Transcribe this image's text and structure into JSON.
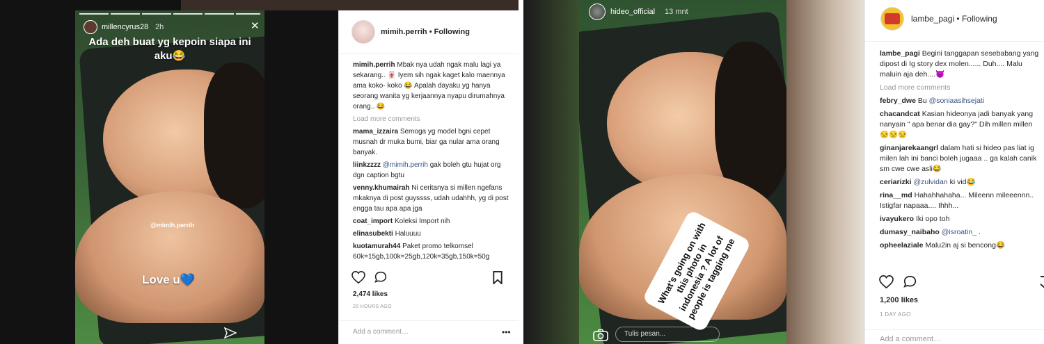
{
  "left": {
    "story": {
      "username": "millencyrus28",
      "time": "2h",
      "caption": "Ada deh buat yg kepoin siapa ini aku😂",
      "tag_text": "@mimih.perrih",
      "love_text": "Love u💙"
    },
    "post": {
      "username": "mimih.perrih",
      "follow_status": "Following",
      "caption_user": "mimih.perrih",
      "caption_text": "Mbak nya udah ngak malu lagi ya sekarang.. 🀄 Iyem sih ngak kaget kalo maennya ama koko- koko 😂 Apalah dayaku yg hanya seorang wanita yg kerjaannya nyapu dirumahnya orang.. 😂",
      "load_more": "Load more comments",
      "comments": [
        {
          "user": "mama_izzaira",
          "mention": "",
          "text": "Semoga yg model bgni cepet musnah dr muka bumi, biar ga nular ama orang banyak."
        },
        {
          "user": "liinkzzzz",
          "mention": "@mimih.perrih",
          "text": "gak boleh gtu hujat org dgn caption bgtu"
        },
        {
          "user": "venny.khumairah",
          "mention": "",
          "text": "Ni ceritanya si millen ngefans mkaknya di post guyssss, udah udahhh, yg di post engga tau apa apa jga"
        },
        {
          "user": "coat_import",
          "mention": "",
          "text": "Koleksi Import nih"
        },
        {
          "user": "elinasubekti",
          "mention": "",
          "text": "Haluuuu"
        },
        {
          "user": "kuotamurah44",
          "mention": "",
          "text": "Paket promo telkomsel 60k=15gb,100k=25gb,120k=35gb,150k=50g"
        }
      ],
      "likes": "2,474 likes",
      "time_ago": "20 HOURS AGO",
      "add_comment": "Add a comment…",
      "more_glyph": "•••"
    }
  },
  "right": {
    "story": {
      "username": "hideo_official",
      "time": "13 mnt",
      "sticker_text": "What's going on with this photo in indonesia ? A lot of people is tagging me",
      "reply_placeholder": "Tulis pesan..."
    },
    "post": {
      "username": "lambe_pagi",
      "follow_status": "Following",
      "caption_user": "lambe_pagi",
      "caption_text": "Begini tanggapan sesebabang yang dipost di Ig story dex molen...... Duh.... Malu maluin aja deh....😈",
      "load_more": "Load more comments",
      "comments": [
        {
          "user": "febry_dwe",
          "mention": "@soniaasihsejati",
          "text": "Bu"
        },
        {
          "user": "chacandcat",
          "mention": "",
          "text": "Kasian hideonya jadi banyak yang nanyain \" apa benar dia gay?\" Dih millen millen😒😒😒"
        },
        {
          "user": "ginanjarekaangrl",
          "mention": "",
          "text": "dalam hati si hideo pas liat ig milen lah ini banci boleh jugaaa .. ga kalah canik sm cwe cwe asli😂"
        },
        {
          "user": "ceriarizki",
          "mention": "@zulvidan",
          "text": "ki vid😂"
        },
        {
          "user": "rina__md",
          "mention": "",
          "text": "Hahahhahaha... Mileenn mileeennn.. Istigfar napaaa.... Ihhh..."
        },
        {
          "user": "ivayukero",
          "mention": "",
          "text": "Iki opo toh"
        },
        {
          "user": "dumasy_naibaho",
          "mention": "@isroatin_",
          "text": "."
        },
        {
          "user": "opheelaziale",
          "mention": "",
          "text": "Malu2in aj si bencong😂"
        }
      ],
      "likes": "1,200 likes",
      "time_ago": "1 DAY AGO",
      "add_comment": "Add a comment…"
    }
  },
  "colors": {
    "text": "#262626",
    "muted": "#999999",
    "link": "#385185",
    "border": "#efefef"
  }
}
